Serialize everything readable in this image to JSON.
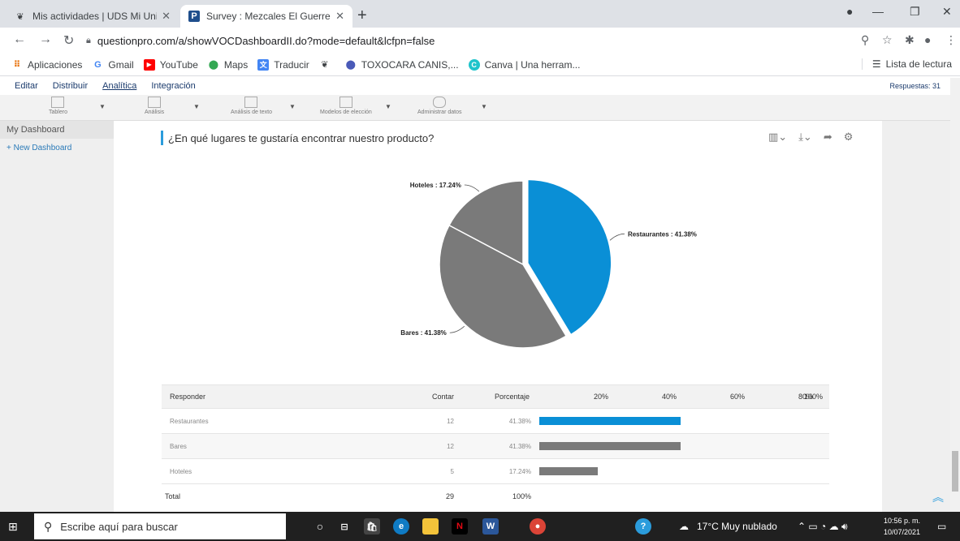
{
  "browser": {
    "tabs": [
      {
        "title": "Mis actividades | UDS Mi Univers",
        "close": "✕"
      },
      {
        "title": "Survey : Mezcales El Guerrerense",
        "close": "✕"
      }
    ],
    "new_tab": "+",
    "url": "questionpro.com/a/showVOCDashboardII.do?mode=default&lcfpn=false",
    "bookmarks": [
      "Aplicaciones",
      "Gmail",
      "YouTube",
      "Maps",
      "Traducir",
      "",
      "TOXOCARA CANIS,...",
      "Canva | Una herram..."
    ],
    "reading_list": "Lista de lectura"
  },
  "app": {
    "menu": [
      "Editar",
      "Distribuir",
      "Analítica",
      "Integración"
    ],
    "active_menu": "Analítica",
    "responses": "Respuestas: 31",
    "tools": [
      "Tablero",
      "Análisis",
      "Análisis de texto",
      "Modelos de elección",
      "Administrar datos"
    ],
    "sidebar": {
      "dashboard": "My Dashboard",
      "new_dashboard": "+ New Dashboard"
    },
    "question": "¿En qué lugares te gustaría encontrar nuestro producto?"
  },
  "chart_data": {
    "type": "pie",
    "categories": [
      "Restaurantes",
      "Bares",
      "Hoteles"
    ],
    "values": [
      41.38,
      41.38,
      17.24
    ],
    "colors": [
      "#0a8fd6",
      "#7a7a7a",
      "#7a7a7a"
    ],
    "labels": [
      "Restaurantes : 41.38%",
      "Bares : 41.38%",
      "Hoteles : 17.24%"
    ],
    "exploded": "Restaurantes"
  },
  "table": {
    "headers": {
      "responder": "Responder",
      "count": "Contar",
      "percent": "Porcentaje"
    },
    "ticks": [
      "20%",
      "40%",
      "60%",
      "80%",
      "100%"
    ],
    "rows": [
      {
        "label": "Restaurantes",
        "count": "12",
        "pct": "41.38%",
        "value": 41.38,
        "color": "#0a8fd6"
      },
      {
        "label": "Bares",
        "count": "12",
        "pct": "41.38%",
        "value": 41.38,
        "color": "#7a7a7a"
      },
      {
        "label": "Hoteles",
        "count": "5",
        "pct": "17.24%",
        "value": 17.24,
        "color": "#7a7a7a"
      }
    ],
    "total": {
      "label": "Total",
      "count": "29",
      "pct": "100%"
    }
  },
  "taskbar": {
    "search_placeholder": "Escribe aquí para buscar",
    "weather": "17°C  Muy nublado",
    "time": "10:56 p. m.",
    "date": "10/07/2021"
  },
  "icons": [
    "search-icon",
    "lock-icon",
    "star-icon",
    "puzzle-icon",
    "profile-icon",
    "settings-icon",
    "share-icon",
    "download-icon",
    "chart-type-icon"
  ]
}
